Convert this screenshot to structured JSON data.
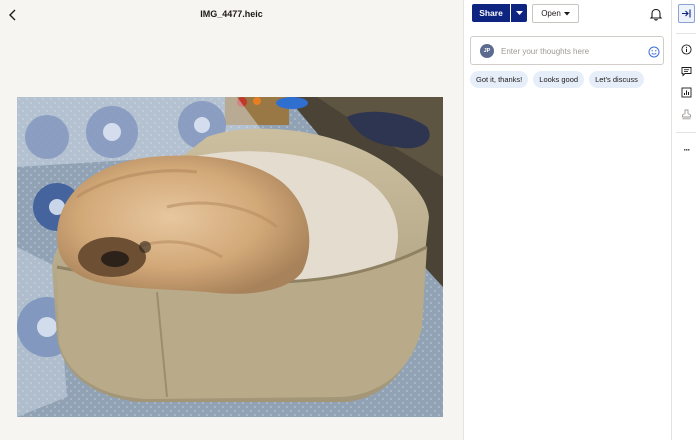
{
  "viewer": {
    "file_name": "IMG_4477.heic"
  },
  "toolbar": {
    "share_label": "Share",
    "open_label": "Open"
  },
  "comment": {
    "avatar_initials": "JP",
    "placeholder": "Enter your thoughts here"
  },
  "quick_replies": [
    {
      "label": "Got it, thanks!"
    },
    {
      "label": "Looks good"
    },
    {
      "label": "Let’s discuss"
    }
  ],
  "rail": {
    "more_label": "···",
    "items": [
      "collapse-panel-icon",
      "info-icon",
      "comment-icon",
      "activity-chart-icon",
      "stamp-icon"
    ]
  },
  "colors": {
    "primary": "#0d2481",
    "chip_bg": "#e6eef9",
    "viewer_bg": "#f7f5f2"
  }
}
